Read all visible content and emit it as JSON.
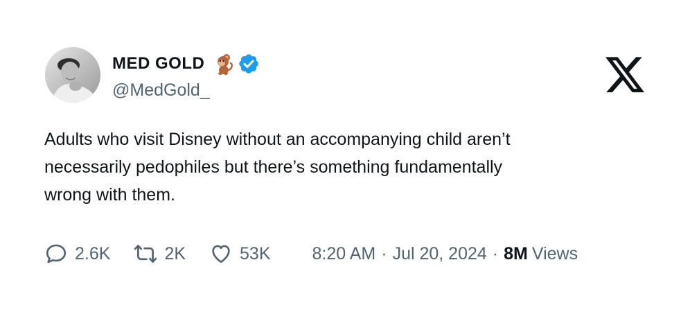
{
  "author": {
    "display_name": "MED GOLD",
    "handle": "@MedGold_",
    "emoji_icon": "monkey-emoji-icon",
    "verified_icon": "verified-badge-icon",
    "verified_color": "#1d9bf0"
  },
  "platform_icon": "x-logo-icon",
  "tweet": {
    "lines": [
      "Adults who visit Disney without an accompanying child aren’t",
      "necessarily pedophiles but there’s something fundamentally",
      "wrong with them."
    ]
  },
  "metrics": {
    "replies": "2.6K",
    "reposts": "2K",
    "likes": "53K"
  },
  "meta": {
    "time": "8:20 AM",
    "separator": "·",
    "date": "Jul 20, 2024",
    "views_count": "8M",
    "views_label": "Views"
  },
  "colors": {
    "text_primary": "#0f1419",
    "text_secondary": "#536471"
  }
}
